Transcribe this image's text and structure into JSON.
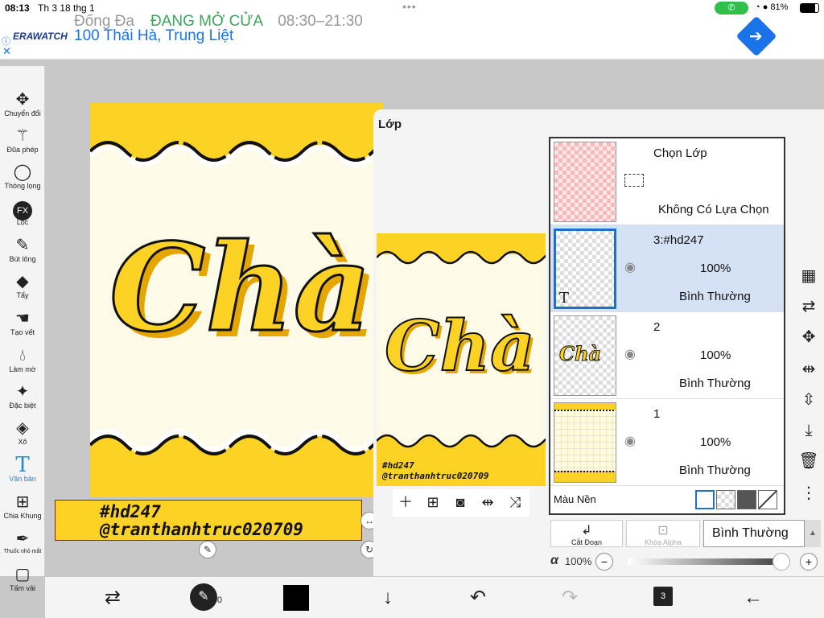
{
  "status_bar": {
    "time": "08:13",
    "date": "Th 3 18 thg 1",
    "battery": "81%",
    "battery_level": 0.81,
    "call_icon": "phone-icon"
  },
  "ad": {
    "brand": "ERAWATCH",
    "topline_name": "Đống Đa",
    "topline_status": "ĐANG MỞ CỬA",
    "topline_hours": "08:30–21:30",
    "address": "100 Thái Hà, Trung Liệt"
  },
  "left_tools": [
    {
      "name": "transform",
      "label": "Chuyển đổi",
      "icon": "move-arrows-icon"
    },
    {
      "name": "magic-wand",
      "label": "Đũa phép",
      "icon": "magic-wand-icon"
    },
    {
      "name": "lasso",
      "label": "Thòng lọng",
      "icon": "lasso-icon"
    },
    {
      "name": "filter",
      "label": "Lọc",
      "icon": "fx-icon"
    },
    {
      "name": "brush",
      "label": "Bút lông",
      "icon": "brush-icon"
    },
    {
      "name": "eraser",
      "label": "Tẩy",
      "icon": "eraser-icon"
    },
    {
      "name": "smudge",
      "label": "Tạo vết",
      "icon": "smudge-icon"
    },
    {
      "name": "blur",
      "label": "Làm mờ",
      "icon": "drop-icon"
    },
    {
      "name": "special",
      "label": "Đặc biệt",
      "icon": "sparkle-icon"
    },
    {
      "name": "fill",
      "label": "Xô",
      "icon": "bucket-icon"
    },
    {
      "name": "text",
      "label": "Văn bản",
      "icon": "text-icon"
    },
    {
      "name": "frame",
      "label": "Chia Khung",
      "icon": "frame-icon"
    },
    {
      "name": "eyedropper",
      "label": "Thuốc nhỏ mắt",
      "icon": "eyedropper-icon"
    },
    {
      "name": "canvas",
      "label": "Tấm vải",
      "icon": "canvas-icon"
    }
  ],
  "canvas": {
    "artwork_text": "Chà",
    "caption_line1": "#hd247",
    "caption_line2": "@tranthanhtruc020709",
    "accent": "#fcd325"
  },
  "layer_panel": {
    "title": "Lớp",
    "selection_layer": {
      "name": "Chọn Lớp",
      "status": "Không Có Lựa Chọn"
    },
    "layers": [
      {
        "name": "3:#hd247",
        "opacity": "100%",
        "blend": "Bình Thường",
        "selected": true
      },
      {
        "name": "2",
        "opacity": "100%",
        "blend": "Bình Thường",
        "selected": false
      },
      {
        "name": "1",
        "opacity": "100%",
        "blend": "Bình Thường",
        "selected": false
      }
    ],
    "thumb_text_glyph": "T",
    "background_label": "Màu Nền",
    "clip_label": "Cắt Đoạn",
    "alpha_lock_label": "Khóa Alpha",
    "blend_mode_value": "Bình Thường",
    "alpha_symbol": "α",
    "alpha_value": "100%",
    "alpha_fraction": 1.0
  },
  "bottom_toolbar": {
    "brush_size": "50",
    "layer_count": "3",
    "current_color": "#000000"
  },
  "colors": {
    "yellow": "#fcd325",
    "paper": "#fdfbe8",
    "selected_layer": "#d5e1f5",
    "accent_blue": "#1e88e5"
  }
}
